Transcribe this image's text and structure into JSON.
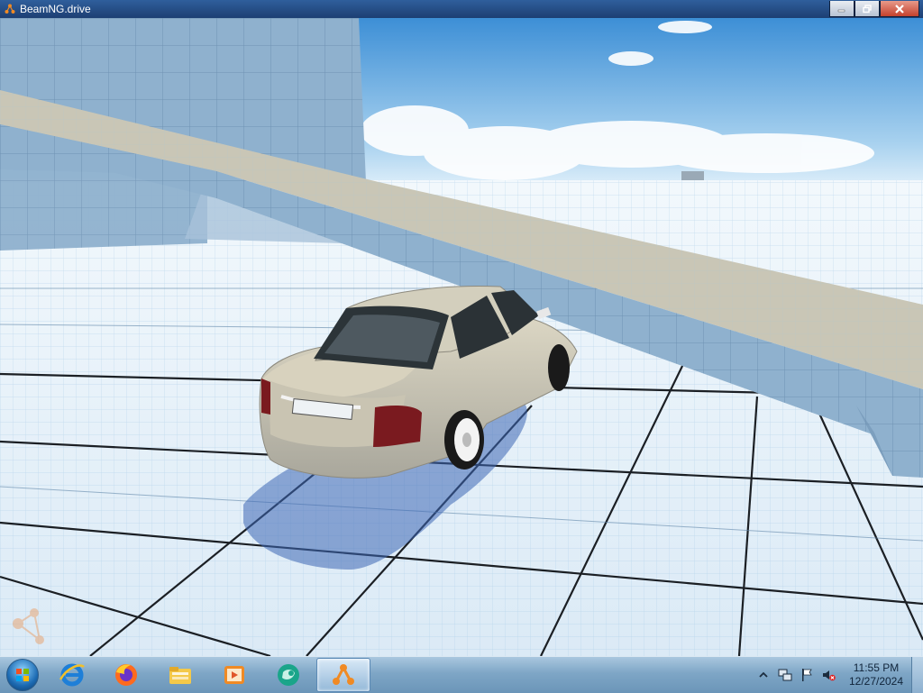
{
  "window": {
    "title": "BeamNG.drive",
    "controls": {
      "minimize_icon": "minimize-icon",
      "maximize_icon": "maximize-icon",
      "close_icon": "close-icon"
    }
  },
  "game": {
    "scene": "grid test map with elevated ramp",
    "vehicle": {
      "color": "#c9c3ad",
      "type": "sedan"
    }
  },
  "taskbar": {
    "start_icon": "windows-start-orb",
    "pinned": [
      {
        "name": "internet-explorer-icon",
        "active": false
      },
      {
        "name": "firefox-icon",
        "active": false
      },
      {
        "name": "file-explorer-icon",
        "active": false
      },
      {
        "name": "media-player-icon",
        "active": false
      },
      {
        "name": "teal-app-icon",
        "active": false
      },
      {
        "name": "beamng-icon",
        "active": true
      }
    ],
    "tray": {
      "icons": [
        "show-hidden-icons",
        "network-icon",
        "action-center-flag-icon",
        "volume-muted-icon"
      ],
      "time": "11:55 PM",
      "date": "12/27/2024"
    }
  },
  "colors": {
    "titlebar": "#1d3f73",
    "taskbar": "#7ea6c6",
    "sky": "#8fc4ee",
    "floor": "#e8f3fb"
  }
}
